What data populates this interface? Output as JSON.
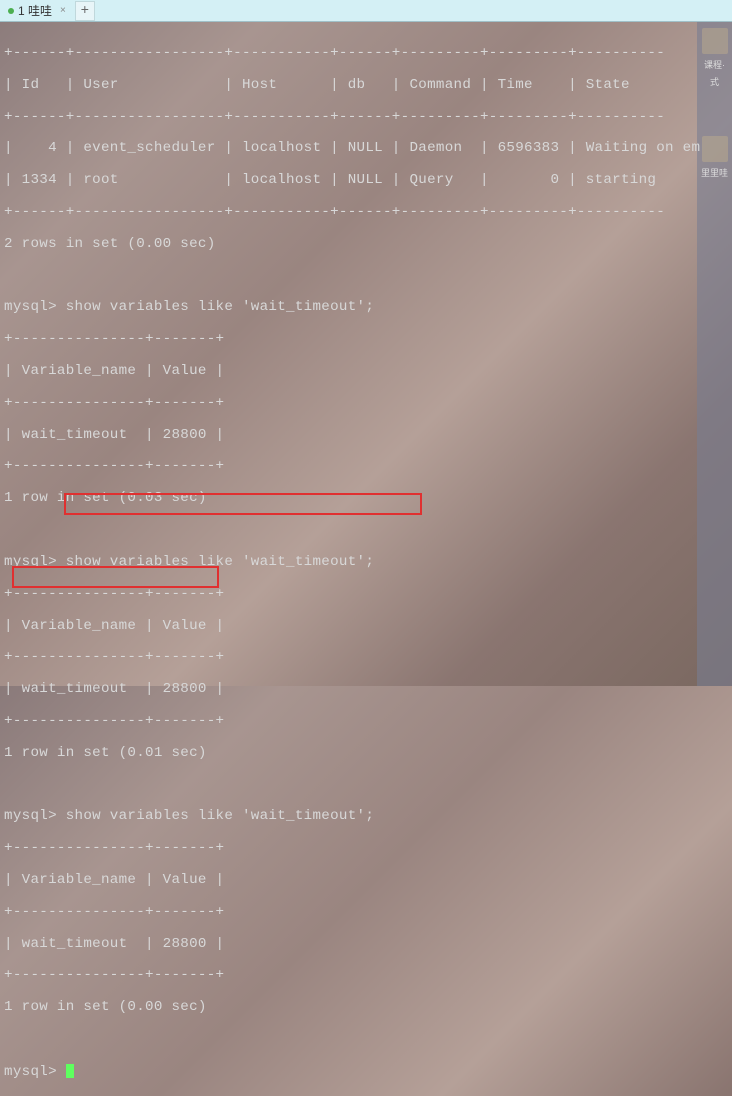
{
  "tab": {
    "title": "1 哇哇",
    "close_symbol": "×",
    "new_tab_symbol": "+"
  },
  "side": {
    "label1": "课程·",
    "label2": "式",
    "label3": "里里哇"
  },
  "processlist": {
    "border": "+------+-----------------+-----------+------+---------+---------+----------",
    "header": "| Id   | User            | Host      | db   | Command | Time    | State    ",
    "row1": "|    4 | event_scheduler | localhost | NULL | Daemon  | 6596383 | Waiting on em",
    "row2": "| 1334 | root            | localhost | NULL | Query   |       0 | starting ",
    "footer_text": "2 rows in set (0.00 sec)"
  },
  "q1": {
    "prompt": "mysql>",
    "cmd": " show variables like 'wait_timeout';",
    "border": "+---------------+-------+",
    "header": "| Variable_name | Value |",
    "row": "| wait_timeout  | 28800 |",
    "footer": "1 row in set (0.03 sec)"
  },
  "q2": {
    "prompt": "mysql>",
    "cmd": " show variables like 'wait_timeout';",
    "border": "+---------------+-------+",
    "header": "| Variable_name | Value |",
    "row": "| wait_timeout  | 28800 |",
    "footer": "1 row in set (0.01 sec)"
  },
  "q3": {
    "prompt": "mysql>",
    "cmd": " show variables like 'wait_timeout';",
    "border": "+---------------+-------+",
    "header": "| Variable_name | Value |",
    "row": "| wait_timeout  | 28800 |",
    "footer": "1 row in set (0.00 sec)"
  },
  "prompt_final": "mysql> ",
  "chart_data": {
    "type": "table",
    "title": "SHOW VARIABLES LIKE 'wait_timeout'",
    "columns": [
      "Variable_name",
      "Value"
    ],
    "rows": [
      [
        "wait_timeout",
        28800
      ]
    ]
  }
}
